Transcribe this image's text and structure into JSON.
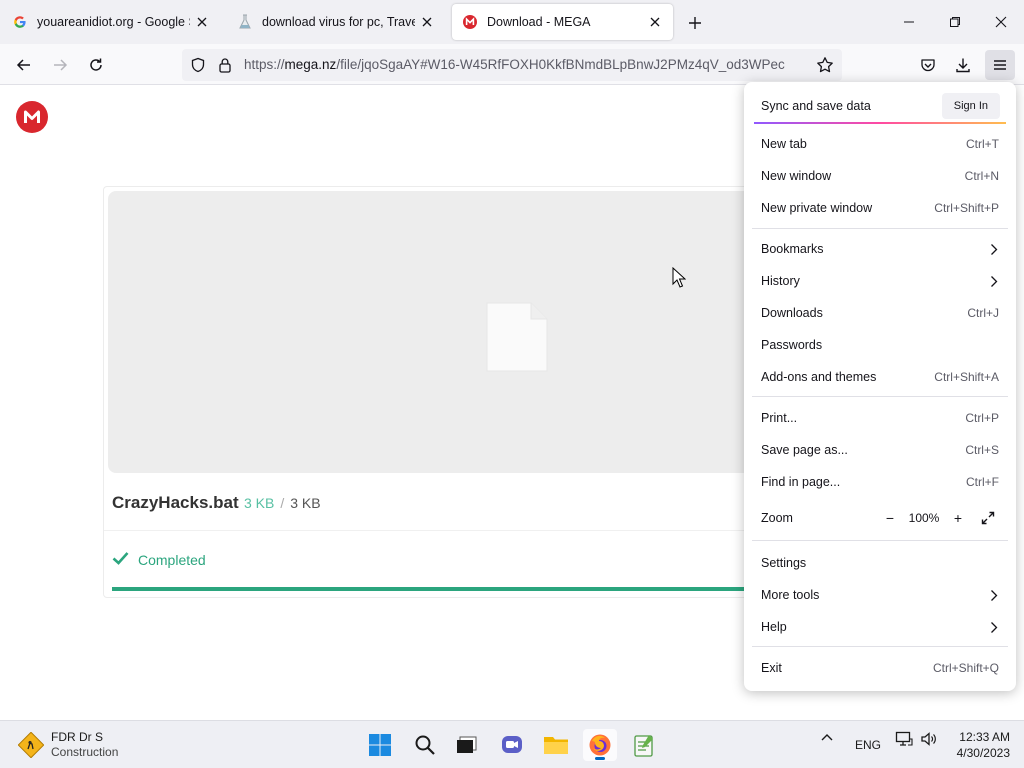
{
  "tabs": [
    {
      "title": "youareanidiot.org - Google Search",
      "favicon": "google-icon",
      "active": false
    },
    {
      "title": "download virus for pc, Travelsearch",
      "favicon": "flask-icon",
      "active": false
    },
    {
      "title": "Download - MEGA",
      "favicon": "mega-icon",
      "active": true
    }
  ],
  "window": {
    "minimize": "minimize-icon",
    "maximize": "maximize-icon",
    "close": "close-icon"
  },
  "nav": {
    "url_prefix": "https://",
    "url_host": "mega.nz",
    "url_path": "/file/jqoSgaAY#W16-W45RfFOXH0KkfBNmdBLpBnwJ2PMz4qV_od3WPec"
  },
  "page": {
    "file_name": "CrazyHacks.bat",
    "size_done": "3 KB",
    "size_sep": "/",
    "size_total": "3 KB",
    "status": "Completed",
    "progress": 1.0,
    "accent": "#2ba57e",
    "brand": "#d9272e"
  },
  "menu": {
    "sync_label": "Sync and save data",
    "signin_label": "Sign In",
    "items": [
      {
        "label": "New tab",
        "shortcut": "Ctrl+T"
      },
      {
        "label": "New window",
        "shortcut": "Ctrl+N"
      },
      {
        "label": "New private window",
        "shortcut": "Ctrl+Shift+P"
      },
      {
        "label": "Bookmarks",
        "shortcut": ""
      },
      {
        "label": "History",
        "shortcut": ""
      },
      {
        "label": "Downloads",
        "shortcut": "Ctrl+J"
      },
      {
        "label": "Passwords",
        "shortcut": ""
      },
      {
        "label": "Add-ons and themes",
        "shortcut": "Ctrl+Shift+A"
      },
      {
        "label": "Print...",
        "shortcut": "Ctrl+P"
      },
      {
        "label": "Save page as...",
        "shortcut": "Ctrl+S"
      },
      {
        "label": "Find in page...",
        "shortcut": "Ctrl+F"
      },
      {
        "label": "Zoom",
        "shortcut": ""
      },
      {
        "label": "Settings",
        "shortcut": ""
      },
      {
        "label": "More tools",
        "shortcut": ""
      },
      {
        "label": "Help",
        "shortcut": ""
      },
      {
        "label": "Exit",
        "shortcut": "Ctrl+Shift+Q"
      }
    ],
    "zoom_minus": "−",
    "zoom_value": "100%",
    "zoom_plus": "+"
  },
  "taskbar": {
    "weather_title": "FDR Dr S",
    "weather_sub": "Construction",
    "lang": "ENG",
    "time": "12:33 AM",
    "date": "4/30/2023"
  }
}
